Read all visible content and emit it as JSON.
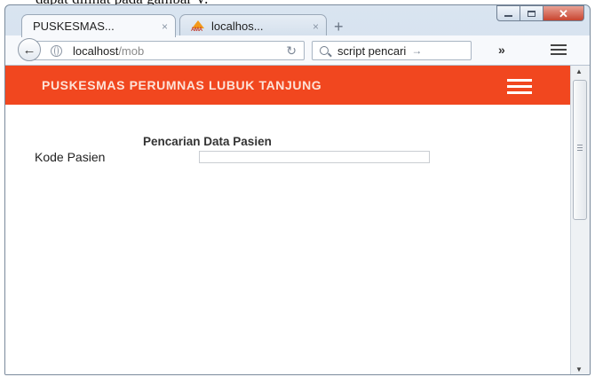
{
  "document": {
    "caption": "dapat dilihat pada gambar V."
  },
  "browser": {
    "tabs": [
      {
        "label": "PUSKESMAS...",
        "close": "×",
        "active": true
      },
      {
        "label": "localhos...",
        "close": "×",
        "active": false,
        "favicon_text": "AMA"
      }
    ],
    "new_tab": "+",
    "url": {
      "host": "localhost",
      "path": "/mob"
    },
    "search": {
      "placeholder": "script pencari"
    },
    "icons": [
      "back-arrow-icon",
      "globe-icon",
      "reload-icon",
      "search-icon",
      "go-arrow-icon",
      "overflow-chevron-icon",
      "menu-icon"
    ]
  },
  "app": {
    "header_title": "PUSKESMAS PERUMNAS LUBUK TANJUNG",
    "header_color": "#f1471f"
  },
  "form": {
    "title": "Pencarian Data Pasien",
    "fields": [
      {
        "label": "Kode Pasien",
        "value": ""
      }
    ]
  }
}
